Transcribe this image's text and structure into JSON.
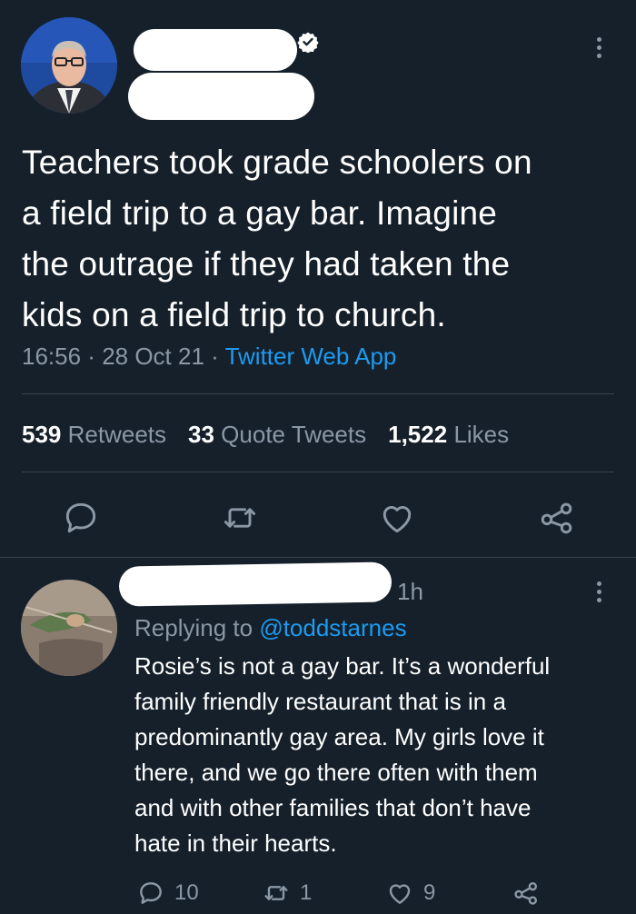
{
  "tweet": {
    "text": "Teachers took grade schoolers on\na field trip to a gay bar. Imagine\nthe outrage if they had taken the\nkids on a field trip to church.",
    "time": "16:56",
    "separator": " · ",
    "date": "28 Oct 21",
    "source": "Twitter Web App",
    "stats": {
      "retweets_count": "539",
      "retweets_label": "Retweets",
      "quotes_count": "33",
      "quotes_label": "Quote Tweets",
      "likes_count": "1,522",
      "likes_label": "Likes"
    },
    "icons": [
      "reply-icon",
      "retweet-icon",
      "like-icon",
      "share-icon"
    ]
  },
  "reply": {
    "time": "1h",
    "replying_prefix": "Replying to ",
    "replying_handle": "@toddstarnes",
    "text": "Rosie’s is not a gay bar. It’s a wonderful\nfamily friendly restaurant that is in a\npredominantly gay area. My girls love it\nthere, and we go there often with them\nand with other families that don’t have\nhate in their hearts.",
    "counts": {
      "replies": "10",
      "retweets": "1",
      "likes": "9"
    }
  },
  "colors": {
    "background": "#15202b",
    "text": "#ffffff",
    "secondary": "#8b98a5",
    "accent": "#1d9bf0",
    "divider": "#38444d"
  }
}
